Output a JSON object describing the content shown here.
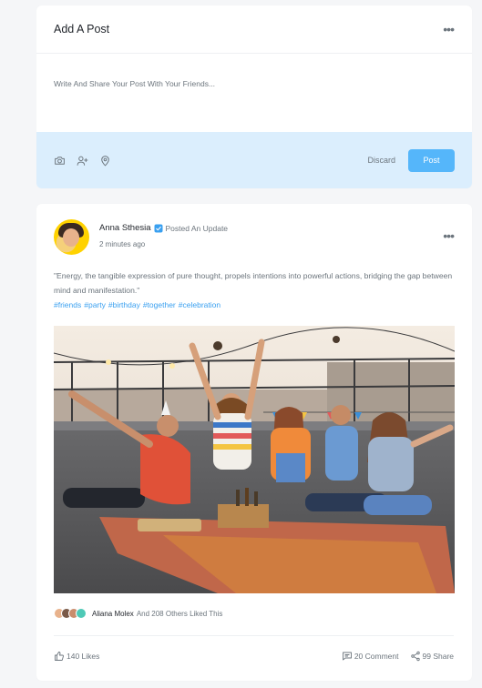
{
  "add_post": {
    "title": "Add A Post",
    "more_icon": "more-horizontal-icon",
    "placeholder": "Write And Share Your Post With Your Friends...",
    "tools": [
      "camera-icon",
      "user-plus-icon",
      "location-pin-icon"
    ],
    "discard_label": "Discard",
    "post_label": "Post"
  },
  "feed_post": {
    "author": "Anna Sthesia",
    "action": "Posted An Update",
    "time": "2 minutes ago",
    "text": "\"Energy, the tangible expression of pure thought, propels intentions into powerful actions, bridging the gap between mind and manifestation.\"",
    "hashtags": [
      "#friends",
      "#party",
      "#birthday",
      "#together",
      "#celebration"
    ],
    "liked_by": "Aliana Molex",
    "liked_rest": "And 208 Others Liked This",
    "likes": "140 Likes",
    "comments": "20 Comment",
    "shares": "99 Share"
  },
  "colors": {
    "accent": "#55b6fa",
    "footer_bg": "#dbeefd",
    "hashtag": "#3aa0f0",
    "page_bg": "#f5f6f8"
  }
}
